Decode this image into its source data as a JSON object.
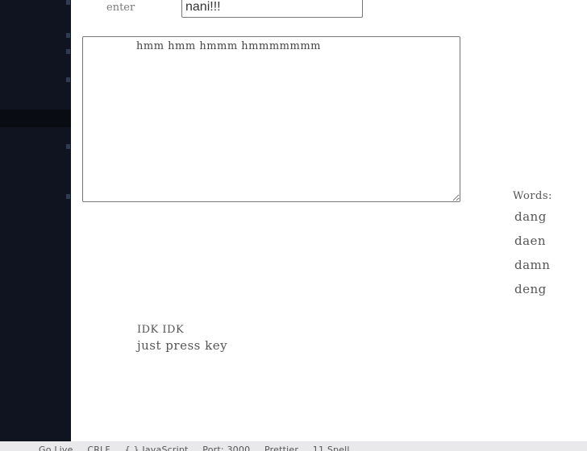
{
  "form": {
    "field_label": "enter",
    "input_value": "nani!!!",
    "textarea_value": "hmm hmm hmmm hmmmmmmm"
  },
  "word_list": {
    "title": "Words:",
    "items": [
      "dang",
      "daen",
      "damn",
      "deng"
    ]
  },
  "output": {
    "line1": "IDK IDK",
    "line2": "just press key"
  },
  "status_bar": {
    "items": [
      "Go Live",
      "CRLF",
      "{ } JavaScript",
      "Port: 3000",
      "Prettier",
      "11 Spell"
    ]
  }
}
